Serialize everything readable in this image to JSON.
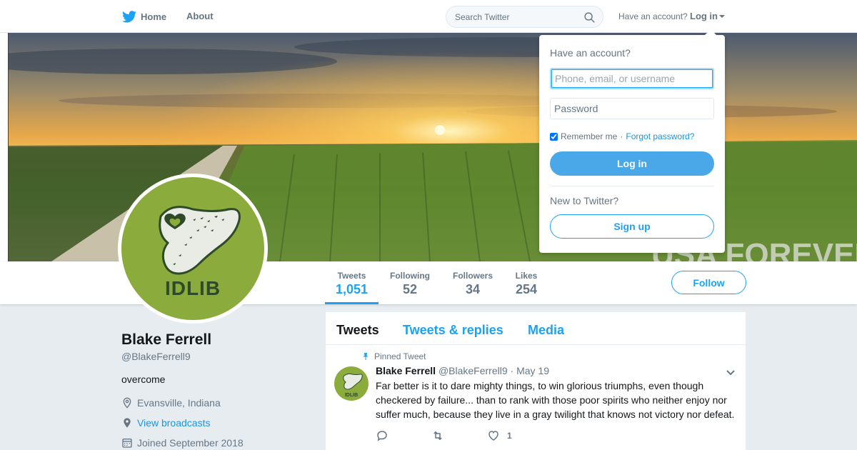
{
  "nav": {
    "home_label": "Home",
    "about_label": "About",
    "search_placeholder": "Search Twitter",
    "have_account": "Have an account?",
    "login_label": "Log in"
  },
  "login_dropdown": {
    "title": "Have an account?",
    "username_placeholder": "Phone, email, or username",
    "password_placeholder": "Password",
    "remember_label": "Remember me",
    "separator": "·",
    "forgot_label": "Forgot password?",
    "login_button": "Log in",
    "new_label": "New to Twitter?",
    "signup_button": "Sign up"
  },
  "banner": {
    "overlay_text": "USA FOREVER"
  },
  "profile": {
    "avatar_text": "IDLIB",
    "name": "Blake Ferrell",
    "handle": "@BlakeFerrell9",
    "bio": "overcome",
    "location": "Evansville, Indiana",
    "broadcasts": "View broadcasts",
    "joined": "Joined September 2018"
  },
  "stats": [
    {
      "label": "Tweets",
      "value": "1,051"
    },
    {
      "label": "Following",
      "value": "52"
    },
    {
      "label": "Followers",
      "value": "34"
    },
    {
      "label": "Likes",
      "value": "254"
    }
  ],
  "follow_button": "Follow",
  "timeline": {
    "tabs": [
      "Tweets",
      "Tweets & replies",
      "Media"
    ],
    "pinned_label": "Pinned Tweet",
    "tweet": {
      "avatar_text": "IDLIB",
      "name": "Blake Ferrell",
      "handle": "@BlakeFerrell9",
      "date": "· May 19",
      "text": "Far better is it to dare mighty things, to win glorious triumphs, even though checkered by failure... than to rank with those poor spirits who neither enjoy nor suffer much, because they live in a gray twilight that knows not victory nor defeat.",
      "like_count": "1"
    }
  },
  "colors": {
    "accent": "#1da1f2",
    "avatar_green": "#8bac3c"
  }
}
